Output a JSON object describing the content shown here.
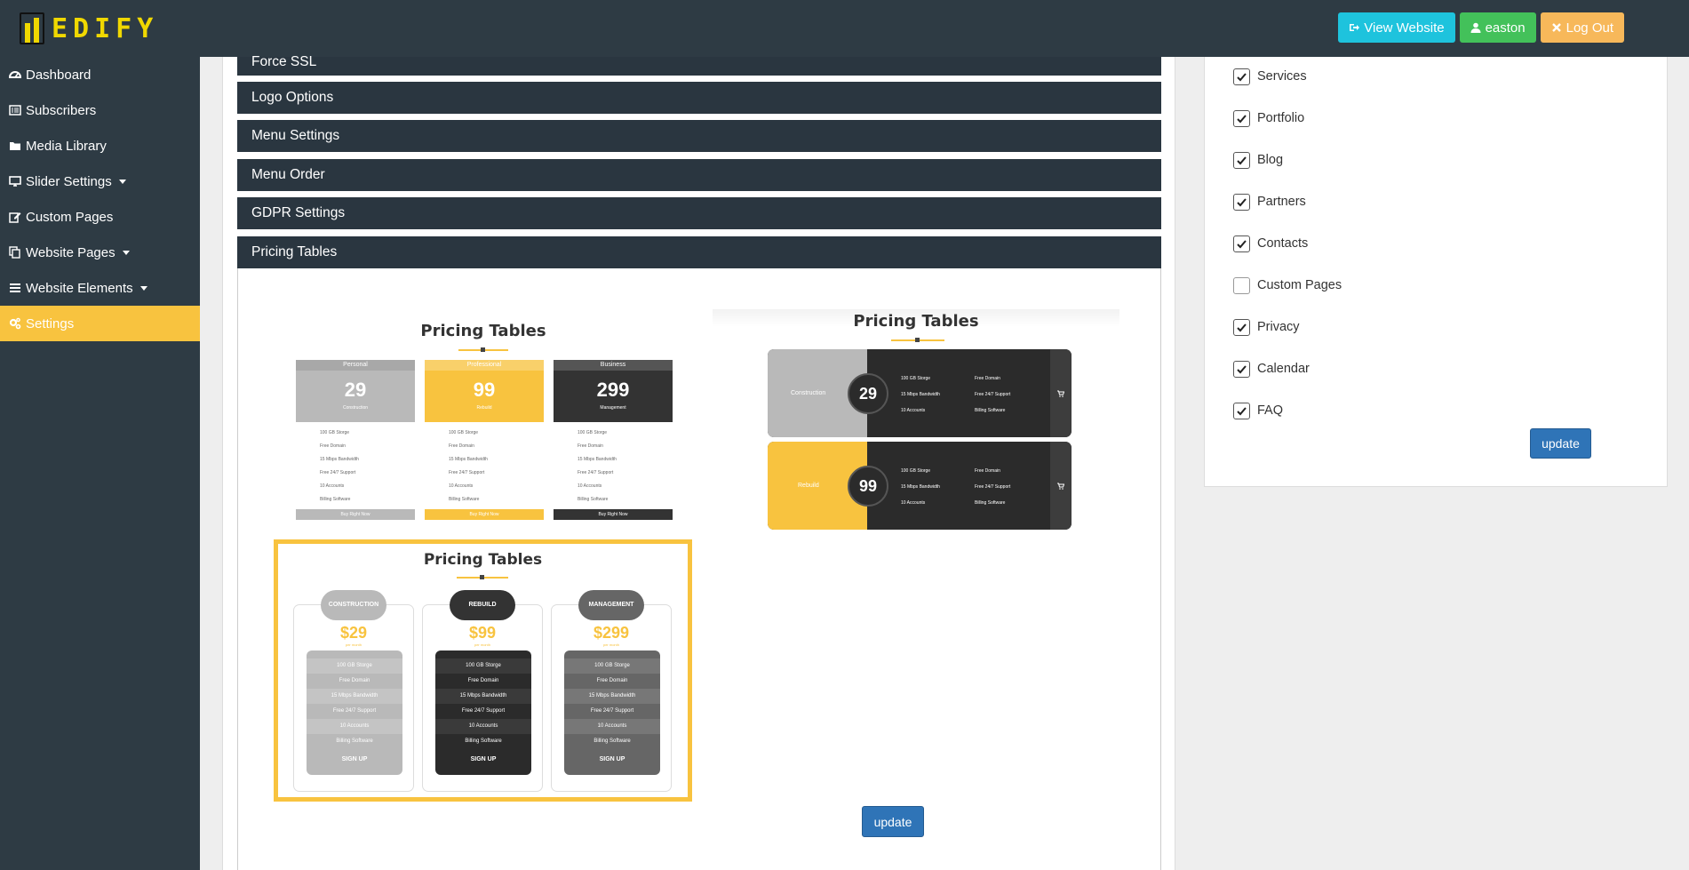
{
  "header": {
    "logo_text": "EDIFY",
    "view_website": "View Website",
    "user": "easton",
    "logout": "Log Out"
  },
  "sidebar": {
    "items": [
      {
        "label": "Dashboard",
        "icon": "dashboard-icon"
      },
      {
        "label": "Subscribers",
        "icon": "list-icon"
      },
      {
        "label": "Media Library",
        "icon": "folder-icon"
      },
      {
        "label": "Slider Settings",
        "icon": "desktop-icon",
        "dropdown": true
      },
      {
        "label": "Custom Pages",
        "icon": "edit-icon"
      },
      {
        "label": "Website Pages",
        "icon": "copy-icon",
        "dropdown": true
      },
      {
        "label": "Website Elements",
        "icon": "bars-icon",
        "dropdown": true
      },
      {
        "label": "Settings",
        "icon": "cogs-icon",
        "active": true
      }
    ]
  },
  "panels": [
    "Force SSL",
    "Logo Options",
    "Menu Settings",
    "Menu Order",
    "GDPR Settings",
    "Pricing Tables"
  ],
  "pricing": {
    "update_label": "update",
    "title": "Pricing Tables",
    "style1": {
      "plans": [
        {
          "name": "Personal",
          "price": "29",
          "sub": "Construction"
        },
        {
          "name": "Professional",
          "price": "99",
          "sub": "Rebuild"
        },
        {
          "name": "Business",
          "price": "299",
          "sub": "Management"
        }
      ],
      "features": [
        "100 GB Storge",
        "Free Domain",
        "15 Mbps Bandwidth",
        "Free 24/7 Support",
        "10 Accounts",
        "Billing Software"
      ],
      "cta": "Buy Right Now"
    },
    "style2": {
      "rows": [
        {
          "label": "Construction",
          "price": "29"
        },
        {
          "label": "Rebuild",
          "price": "99"
        }
      ],
      "features_left": [
        "100 GB Storge",
        "15 Mbps Bandwidth",
        "10 Accounts"
      ],
      "features_right": [
        "Free Domain",
        "Free 24/7 Support",
        "Billing Software"
      ]
    },
    "style3": {
      "plans": [
        {
          "name": "CONSTRUCTION",
          "price": "$29"
        },
        {
          "name": "REBUILD",
          "price": "$99"
        },
        {
          "name": "MANAGEMENT",
          "price": "$299"
        }
      ],
      "per": "per month",
      "features": [
        "100 GB Storge",
        "Free Domain",
        "15 Mbps Bandwidth",
        "Free 24/7 Support",
        "10 Accounts",
        "Billing Software"
      ],
      "cta": "SIGN UP"
    }
  },
  "menu_items": [
    {
      "label": "Services",
      "checked": true
    },
    {
      "label": "Portfolio",
      "checked": true
    },
    {
      "label": "Blog",
      "checked": true
    },
    {
      "label": "Partners",
      "checked": true
    },
    {
      "label": "Contacts",
      "checked": true
    },
    {
      "label": "Custom Pages",
      "checked": false
    },
    {
      "label": "Privacy",
      "checked": true
    },
    {
      "label": "Calendar",
      "checked": true
    },
    {
      "label": "FAQ",
      "checked": true
    }
  ],
  "menu_update_label": "update",
  "colors": {
    "accent": "#f8c33f",
    "dark": "#2e3b44",
    "primary": "#2f74b7"
  }
}
